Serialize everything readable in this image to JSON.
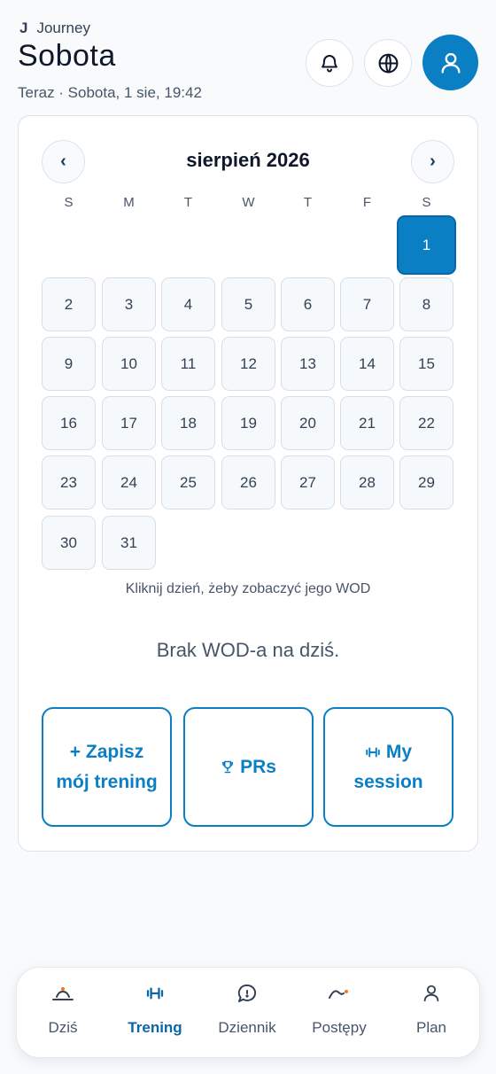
{
  "header": {
    "brand_mark": "J",
    "brand": "Journey",
    "title": "Sobota",
    "subtitle": "Teraz · Sobota, 1 sie, 19:42"
  },
  "calendar": {
    "month_title": "sierpień 2026",
    "prev_label": "‹",
    "next_label": "›",
    "weekdays": [
      "S",
      "M",
      "T",
      "W",
      "T",
      "F",
      "S"
    ],
    "days": [
      "1",
      "2",
      "3",
      "4",
      "5",
      "6",
      "7",
      "8",
      "9",
      "10",
      "11",
      "12",
      "13",
      "14",
      "15",
      "16",
      "17",
      "18",
      "19",
      "20",
      "21",
      "22",
      "23",
      "24",
      "25",
      "26",
      "27",
      "28",
      "29",
      "30",
      "31"
    ],
    "selected_day": "1",
    "hint": "Kliknij dzień, żeby zobaczyć jego WOD"
  },
  "wod": {
    "empty_message": "Brak WOD-a na dziś."
  },
  "actions": {
    "log_workout": "+ Zapisz mój trening",
    "prs": "PRs",
    "my_session": "My session"
  },
  "bottom_nav": {
    "items": [
      {
        "label": "Dziś",
        "icon": "sunrise-icon"
      },
      {
        "label": "Trening",
        "icon": "dumbbell-icon",
        "active": true
      },
      {
        "label": "Dziennik",
        "icon": "chat-bubble-icon"
      },
      {
        "label": "Postępy",
        "icon": "trend-line-icon"
      },
      {
        "label": "Plan",
        "icon": "person-icon"
      }
    ]
  },
  "colors": {
    "accent": "#0a7fc4",
    "accent_dark": "#0a66a8",
    "background": "#f8fafc",
    "orange_dot": "#f97316"
  }
}
